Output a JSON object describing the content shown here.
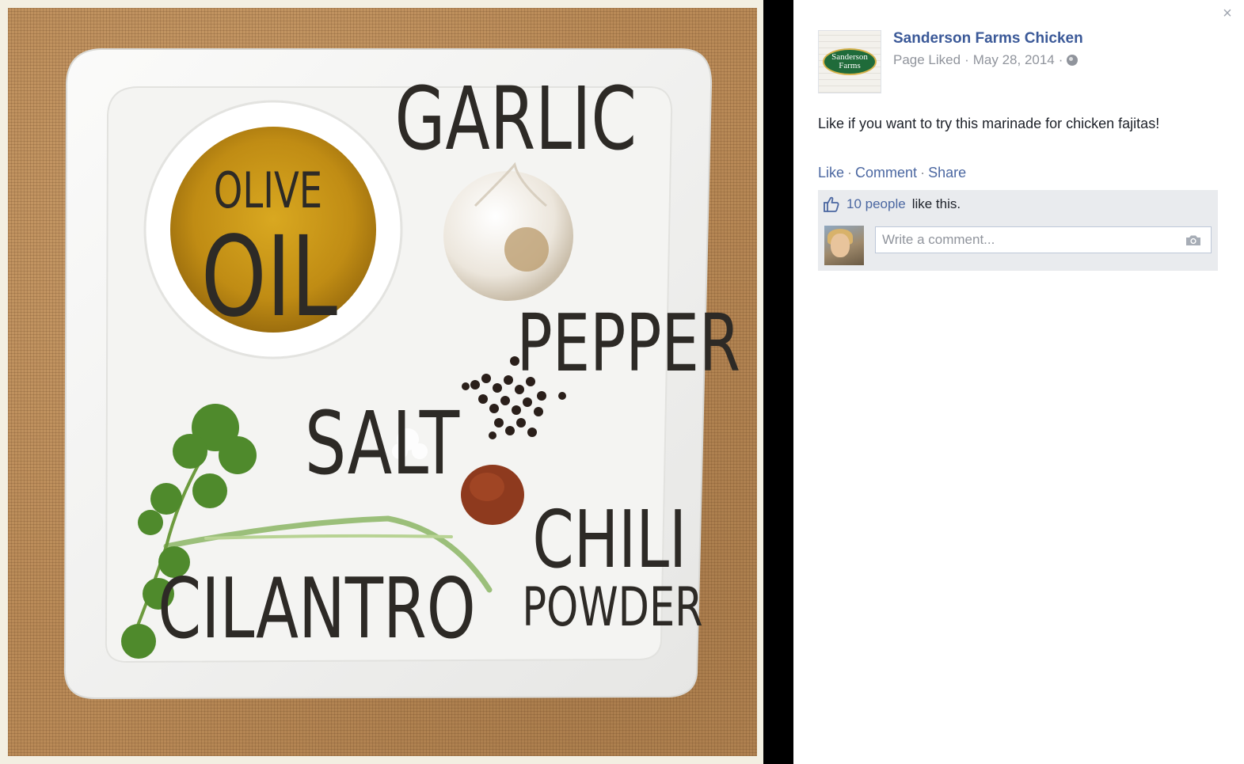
{
  "photo": {
    "labels": {
      "garlic": "GARLIC",
      "olive": "OLIVE",
      "oil": "OIL",
      "pepper": "PEPPER",
      "salt": "SALT",
      "chili": "CHILI",
      "powder": "POWDER",
      "cilantro": "CILANTRO"
    }
  },
  "panel": {
    "close_label": "×",
    "page_name": "Sanderson Farms Chicken",
    "logo_line1": "Sanderson",
    "logo_line2": "Farms",
    "meta": {
      "status": "Page Liked",
      "dot1": "·",
      "date": "May 28, 2014",
      "dot2": "·"
    },
    "post_text": "Like if you want to try this marinade for chicken fajitas!",
    "actions": {
      "like": "Like",
      "comment": "Comment",
      "share": "Share",
      "sep": "·"
    },
    "likes": {
      "people": "10 people",
      "suffix": "like this."
    },
    "comment_placeholder": "Write a comment..."
  },
  "colors": {
    "link": "#4b67a1",
    "page_name": "#3b5998",
    "meta": "#90949c",
    "ufi_bg": "#e9ebee"
  },
  "icons": [
    "close-icon",
    "globe-icon",
    "thumbs-up-icon",
    "camera-icon"
  ]
}
